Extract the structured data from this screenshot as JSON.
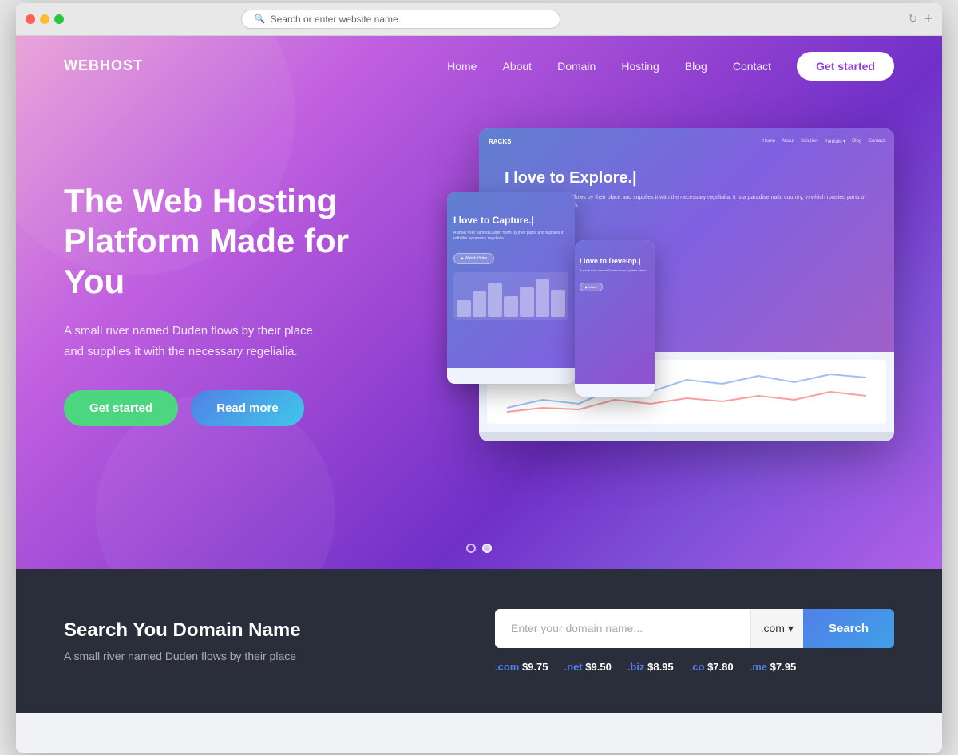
{
  "browser": {
    "url_placeholder": "Search or enter website name"
  },
  "navbar": {
    "logo": "WEBHOST",
    "links": [
      {
        "label": "Home",
        "id": "home"
      },
      {
        "label": "About",
        "id": "about"
      },
      {
        "label": "Domain",
        "id": "domain"
      },
      {
        "label": "Hosting",
        "id": "hosting"
      },
      {
        "label": "Blog",
        "id": "blog"
      },
      {
        "label": "Contact",
        "id": "contact"
      }
    ],
    "cta_label": "Get started"
  },
  "hero": {
    "title": "The Web Hosting Platform Made for You",
    "description": "A small river named Duden flows by their place and supplies it with the necessary regelialia.",
    "btn_get_started": "Get started",
    "btn_read_more": "Read more",
    "laptop": {
      "logo": "RACKS",
      "nav_items": [
        "Home",
        "About",
        "Solution",
        "Portfolio",
        "Blog",
        "Contact"
      ],
      "headline": "I love to Explore.|",
      "subtext": "A small river named Duden flows by their place and supplies it with the necessary regelialia. It is a paradisematic country, in which roasted parts of sentences fly into your mouth.",
      "btn": "▶ Watch Video"
    },
    "tablet": {
      "headline": "I love to Capture.|",
      "subtext": "A small river named Duden flows by their place and supplies it with the necessary regelialia."
    },
    "phone": {
      "headline": "I love to Develop.|",
      "subtext": "A small river named Duden flows by their place."
    },
    "pagination": [
      {
        "active": false
      },
      {
        "active": true
      }
    ]
  },
  "domain_section": {
    "heading": "Search You Domain Name",
    "subtext": "A small river named Duden flows by their place",
    "input_placeholder": "Enter your domain name...",
    "extension_default": ".com",
    "search_btn": "Search",
    "prices": [
      {
        "ext": ".com",
        "price": "$9.75"
      },
      {
        "ext": ".net",
        "price": "$9.50"
      },
      {
        "ext": ".biz",
        "price": "$8.95"
      },
      {
        "ext": ".co",
        "price": "$7.80"
      },
      {
        "ext": ".me",
        "price": "$7.95"
      }
    ]
  }
}
